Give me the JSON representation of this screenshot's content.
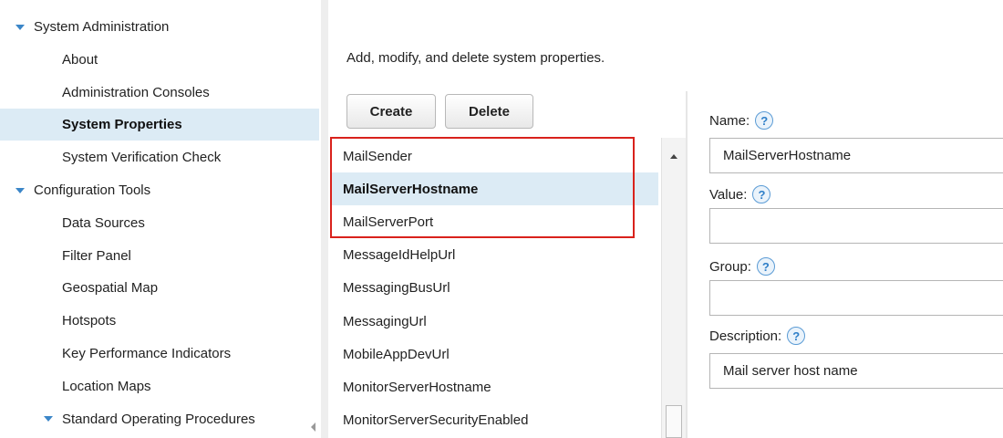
{
  "nav": {
    "items": [
      {
        "label": "System Administration",
        "type": "section"
      },
      {
        "label": "About",
        "type": "child"
      },
      {
        "label": "Administration Consoles",
        "type": "child"
      },
      {
        "label": "System Properties",
        "type": "child",
        "selected": true
      },
      {
        "label": "System Verification Check",
        "type": "child"
      },
      {
        "label": "Configuration Tools",
        "type": "section"
      },
      {
        "label": "Data Sources",
        "type": "child"
      },
      {
        "label": "Filter Panel",
        "type": "child"
      },
      {
        "label": "Geospatial Map",
        "type": "child"
      },
      {
        "label": "Hotspots",
        "type": "child"
      },
      {
        "label": "Key Performance Indicators",
        "type": "child"
      },
      {
        "label": "Location Maps",
        "type": "child"
      },
      {
        "label": "Standard Operating Procedures",
        "type": "subsection"
      }
    ]
  },
  "content": {
    "description": "Add, modify, and delete system properties.",
    "create_label": "Create",
    "delete_label": "Delete"
  },
  "properties": [
    "MailSender",
    "MailServerHostname",
    "MailServerPort",
    "MessageIdHelpUrl",
    "MessagingBusUrl",
    "MessagingUrl",
    "MobileAppDevUrl",
    "MonitorServerHostname",
    "MonitorServerSecurityEnabled"
  ],
  "selected_property": "MailServerHostname",
  "form": {
    "name_label": "Name:",
    "name_value": "MailServerHostname",
    "value_label": "Value:",
    "value_value": "",
    "group_label": "Group:",
    "group_value": "",
    "description_label": "Description:",
    "description_value": "Mail server host name",
    "help_glyph": "?"
  },
  "colors": {
    "selection_bg": "#dcebf5",
    "highlight_border": "#d9221c",
    "accent": "#3b86c8"
  }
}
